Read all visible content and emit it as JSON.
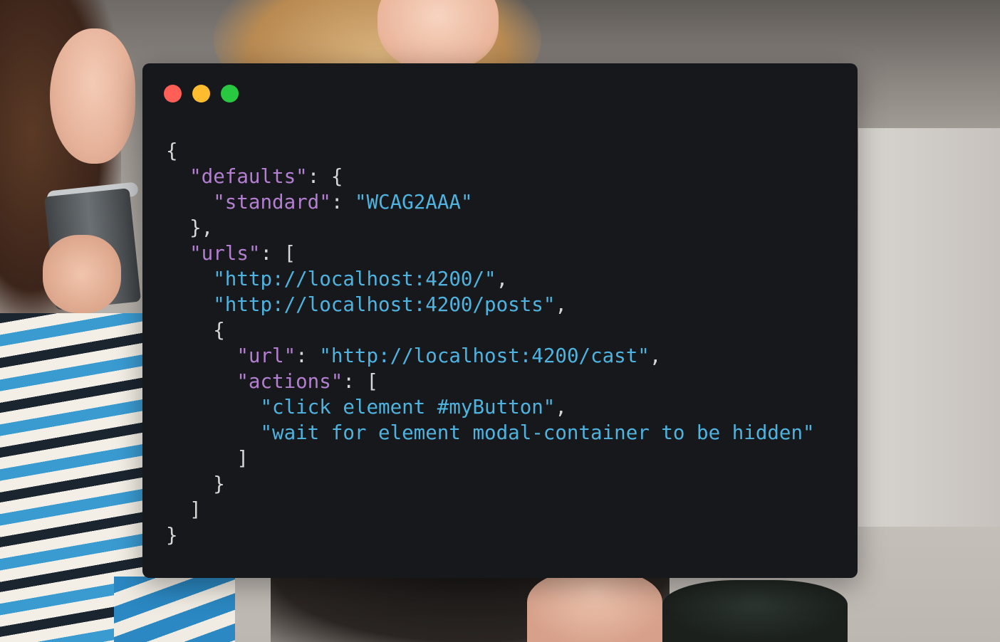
{
  "window": {
    "controls": [
      {
        "name": "close",
        "color": "#ff5f57"
      },
      {
        "name": "minimize",
        "color": "#febc2e"
      },
      {
        "name": "zoom",
        "color": "#28c840"
      }
    ]
  },
  "code": {
    "language": "json",
    "colors": {
      "background": "#17181b",
      "key": "#b37fd0",
      "string": "#4fb3e0",
      "punctuation": "#d7d7d7"
    },
    "lines": [
      [
        {
          "t": "{",
          "c": "punc"
        }
      ],
      [
        {
          "t": "  ",
          "c": "punc"
        },
        {
          "t": "\"defaults\"",
          "c": "key"
        },
        {
          "t": ": {",
          "c": "punc"
        }
      ],
      [
        {
          "t": "    ",
          "c": "punc"
        },
        {
          "t": "\"standard\"",
          "c": "key"
        },
        {
          "t": ": ",
          "c": "punc"
        },
        {
          "t": "\"WCAG2AAA\"",
          "c": "str"
        }
      ],
      [
        {
          "t": "  },",
          "c": "punc"
        }
      ],
      [
        {
          "t": "  ",
          "c": "punc"
        },
        {
          "t": "\"urls\"",
          "c": "key"
        },
        {
          "t": ": [",
          "c": "punc"
        }
      ],
      [
        {
          "t": "    ",
          "c": "punc"
        },
        {
          "t": "\"http://localhost:4200/\"",
          "c": "str"
        },
        {
          "t": ",",
          "c": "punc"
        }
      ],
      [
        {
          "t": "    ",
          "c": "punc"
        },
        {
          "t": "\"http://localhost:4200/posts\"",
          "c": "str"
        },
        {
          "t": ",",
          "c": "punc"
        }
      ],
      [
        {
          "t": "    {",
          "c": "punc"
        }
      ],
      [
        {
          "t": "      ",
          "c": "punc"
        },
        {
          "t": "\"url\"",
          "c": "key"
        },
        {
          "t": ": ",
          "c": "punc"
        },
        {
          "t": "\"http://localhost:4200/cast\"",
          "c": "str"
        },
        {
          "t": ",",
          "c": "punc"
        }
      ],
      [
        {
          "t": "      ",
          "c": "punc"
        },
        {
          "t": "\"actions\"",
          "c": "key"
        },
        {
          "t": ": [",
          "c": "punc"
        }
      ],
      [
        {
          "t": "        ",
          "c": "punc"
        },
        {
          "t": "\"click element #myButton\"",
          "c": "str"
        },
        {
          "t": ",",
          "c": "punc"
        }
      ],
      [
        {
          "t": "        ",
          "c": "punc"
        },
        {
          "t": "\"wait for element modal-container to be hidden\"",
          "c": "str"
        }
      ],
      [
        {
          "t": "      ]",
          "c": "punc"
        }
      ],
      [
        {
          "t": "    }",
          "c": "punc"
        }
      ],
      [
        {
          "t": "  ]",
          "c": "punc"
        }
      ],
      [
        {
          "t": "}",
          "c": "punc"
        }
      ]
    ]
  }
}
